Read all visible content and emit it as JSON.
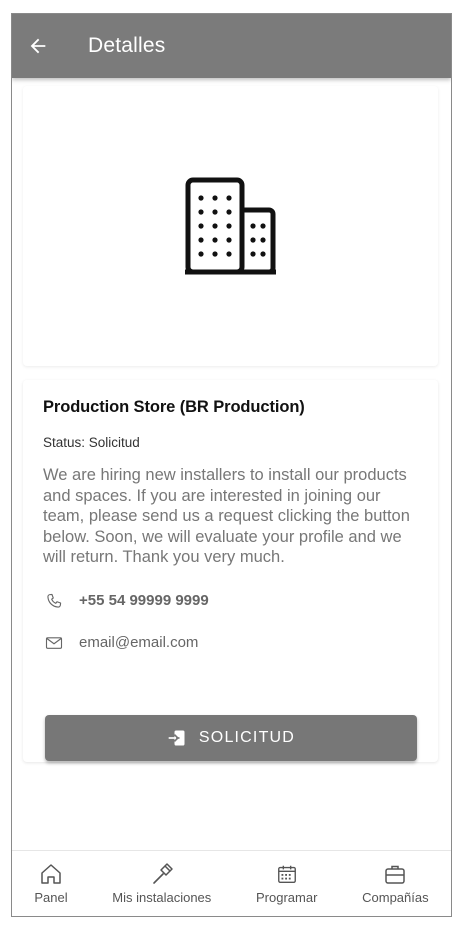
{
  "appbar": {
    "title": "Detalles",
    "back_icon": "arrow-left-icon"
  },
  "image_card": {
    "icon": "building-icon"
  },
  "company": {
    "name": "Production Store (BR Production)",
    "status": "Status: Solicitud",
    "description": "We are hiring new installers to install our products and spaces. If you are interested in joining our team, please send us a request clicking the button below. Soon, we will evaluate your profile and we will return. Thank you very much.",
    "phone": "+55 54 99999 9999",
    "email": "email@email.com",
    "button_label": "SOLICITUD"
  },
  "bottom_nav": {
    "panel": "Panel",
    "installations": "Mis instalaciones",
    "schedule": "Programar",
    "companies": "Compañías"
  },
  "colors": {
    "appbar": "#7b7b7b",
    "button": "#777777",
    "text_muted": "#777777"
  }
}
